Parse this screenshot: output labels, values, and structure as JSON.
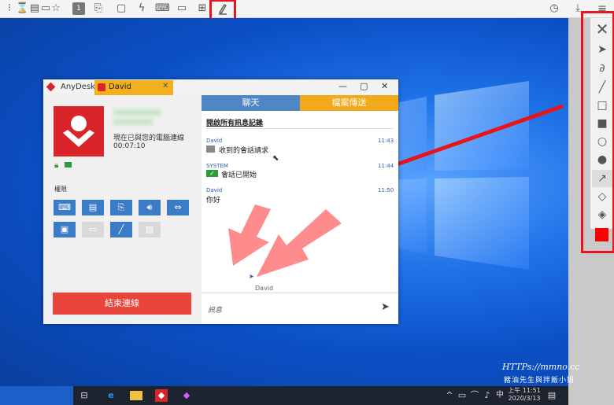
{
  "window": {
    "app_name": "AnyDesk",
    "session_tab": "David",
    "status_text": "現在已與您的電腦連線",
    "duration": "00:07:10",
    "permissions_label": "權限",
    "end_button": "結束連線"
  },
  "chat": {
    "tab_chat": "聊天",
    "tab_file": "檔案傳送",
    "history_link": "開啟所有訊息記錄",
    "messages": [
      {
        "name": "David",
        "time": "11:43",
        "text": "收到的會話請求"
      },
      {
        "name": "SYSTEM",
        "time": "11:44",
        "text": "會話已開始"
      },
      {
        "name": "David",
        "time": "11:50",
        "text": "你好"
      }
    ],
    "cursor_label": "David",
    "input_placeholder": "訊息"
  },
  "taskbar": {
    "ime": "中",
    "time": "上午 11:51",
    "date": "2020/3/13"
  },
  "watermark": {
    "line1": "HTTPs://mmno.cc",
    "line2": "豬油先生與拌飯小姐"
  },
  "colors": {
    "anydesk_red": "#d9252a",
    "session_tab": "#f2b01f",
    "chat_tab": "#4f86c6",
    "file_tab": "#f2a91c",
    "end_button": "#e8453c",
    "annotation_red": "#e8141b",
    "annotation_arrow_pink": "#ff8080"
  }
}
